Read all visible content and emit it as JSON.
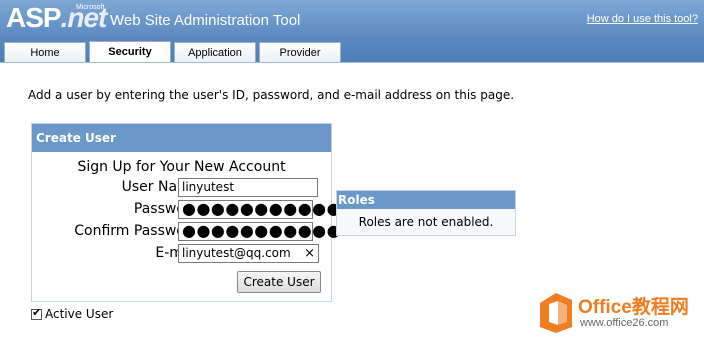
{
  "header": {
    "logo_main": "ASP",
    "logo_net": ".net",
    "logo_ms": "Microsoft",
    "app_title": "Web Site Administration Tool",
    "help_link": "How do I use this tool?"
  },
  "tabs": [
    "Home",
    "Security",
    "Application",
    "Provider"
  ],
  "active_tab": "Security",
  "intro_text": "Add a user by entering the user's ID, password, and e-mail address on this page.",
  "create_user": {
    "panel_title": "Create User",
    "signup_title": "Sign Up for Your New Account",
    "labels": {
      "username": "User Name:",
      "password": "Password:",
      "confirm": "Confirm Password:",
      "email": "E-mail:"
    },
    "values": {
      "username": "linyutest",
      "password": "●●●●●●●●●●●",
      "confirm": "●●●●●●●●●●●",
      "email": "linyutest@qq.com"
    },
    "clear_glyph": "×",
    "button": "Create User"
  },
  "roles": {
    "title": "Roles",
    "message": "Roles are not enabled."
  },
  "active_user": {
    "label": "Active User",
    "checked": true,
    "tick": "✔"
  },
  "watermark": {
    "title": "Office教程网",
    "url": "www.office26.com",
    "icon": "office-logo-icon",
    "color": "#ef7d22"
  }
}
